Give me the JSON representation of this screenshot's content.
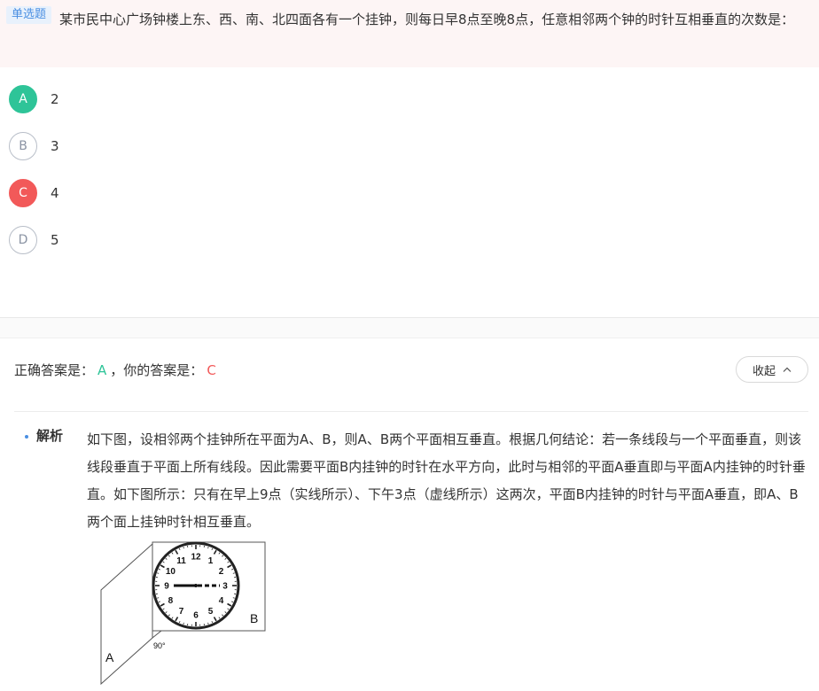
{
  "question": {
    "type_tag": "单选题",
    "text": "某市民中心广场钟楼上东、西、南、北四面各有一个挂钟，则每日早8点至晚8点，任意相邻两个钟的时针互相垂直的次数是："
  },
  "options": [
    {
      "letter": "A",
      "text": "2",
      "state": "correct"
    },
    {
      "letter": "B",
      "text": "3",
      "state": "normal"
    },
    {
      "letter": "C",
      "text": "4",
      "state": "wrong"
    },
    {
      "letter": "D",
      "text": "5",
      "state": "normal"
    }
  ],
  "answer": {
    "correct_label": "正确答案是：",
    "correct_value": "A",
    "separator": "，",
    "yours_label": "你的答案是：",
    "yours_value": "C",
    "collapse_label": "收起"
  },
  "analysis": {
    "title": "解析",
    "text": "如下图，设相邻两个挂钟所在平面为A、B，则A、B两个平面相互垂直。根据几何结论：若一条线段与一个平面垂直，则该线段垂直于平面上所有线段。因此需要平面B内挂钟的时针在水平方向，此时与相邻的平面A垂直即与平面A内挂钟的时针垂直。如下图所示：只有在早上9点（实线所示）、下午3点（虚线所示）这两次，平面B内挂钟的时针与平面A垂直，即A、B两个面上挂钟时针相互垂直。"
  },
  "figure": {
    "plane_a": "A",
    "plane_b": "B",
    "angle_label": "90°",
    "clock_numbers": [
      "12",
      "1",
      "2",
      "3",
      "4",
      "5",
      "6",
      "7",
      "8",
      "9",
      "10",
      "11"
    ]
  },
  "colors": {
    "correct": "#2ec498",
    "wrong": "#f25959",
    "tag_text": "#4a8fe2",
    "tag_bg": "#e8f1fc",
    "header_bg": "#fdf5f5"
  }
}
